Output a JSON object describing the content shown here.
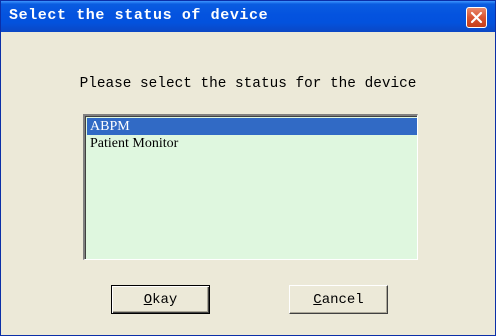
{
  "dialog": {
    "title": "Select the status of device",
    "prompt": "Please select the status for the device",
    "list": {
      "items": [
        {
          "label": "ABPM",
          "selected": true
        },
        {
          "label": "Patient Monitor",
          "selected": false
        }
      ]
    },
    "buttons": {
      "okay": {
        "mnemonic": "O",
        "rest": "kay"
      },
      "cancel": {
        "mnemonic": "C",
        "rest": "ancel"
      }
    }
  },
  "icons": {
    "close": "close-icon"
  },
  "colors": {
    "titlebar": "#0453df",
    "close_button": "#d95432",
    "client_bg": "#ece9d8",
    "listbox_bg": "#dff7df",
    "selection": "#316ac5"
  }
}
